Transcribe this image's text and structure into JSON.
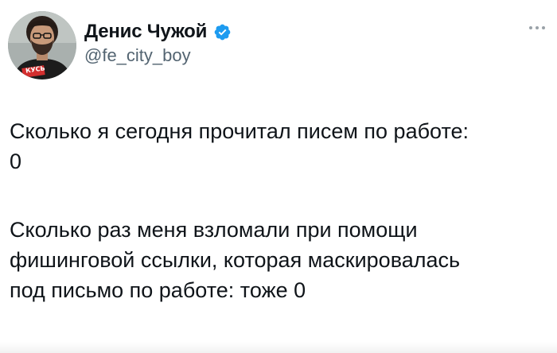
{
  "author": {
    "display_name": "Денис Чужой",
    "handle": "@fe_city_boy",
    "verified": true,
    "avatar_shirt_text": "КУСЬ",
    "verified_color": "#1d9bf0"
  },
  "tweet": {
    "paragraph_1": "Сколько я сегодня прочитал писем по работе:\n0",
    "paragraph_2": "Сколько раз меня взломали при помощи\nфишинговой ссылки, которая маскировалась\nпод письмо по работе: тоже 0"
  },
  "icons": {
    "verified": "verified-badge-icon",
    "more": "more-options-icon"
  }
}
